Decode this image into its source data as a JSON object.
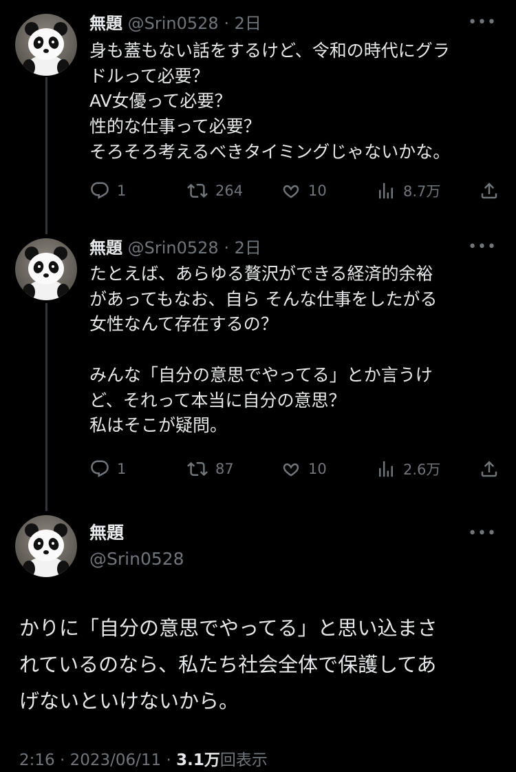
{
  "tweets": [
    {
      "display_name": "無題",
      "handle": "@Srin0528",
      "time": "2日",
      "text": "身も蓋もない話をするけど、令和の時代にグラ\nドルって必要？\nAV女優って必要？\n性的な仕事って必要？\nそろそろ考えるべきタイミングじゃないかな。",
      "replies": "1",
      "retweets": "264",
      "likes": "10",
      "views": "8.7万"
    },
    {
      "display_name": "無題",
      "handle": "@Srin0528",
      "time": "2日",
      "text": "たとえば、あらゆる贅沢ができる経済的余裕\nがあってもなお、自ら そんな仕事をしたがる\n女性なんて存在するの？\n\nみんな「自分の意思でやってる」とか言うけ\nど、それって本当に自分の意思？\n私はそこが疑問。",
      "replies": "1",
      "retweets": "87",
      "likes": "10",
      "views": "2.6万"
    }
  ],
  "main_tweet": {
    "display_name": "無題",
    "handle": "@Srin0528",
    "text": "かりに「自分の意思でやってる」と思い込まさ\nれているのなら、私たち社会全体で保護してあ\nげないといけないから。",
    "time": "2:16",
    "date": "2023/06/11",
    "views_count": "3.1万",
    "views_label": "回表示"
  },
  "colors": {
    "background": "#000000",
    "text": "#e7e9ea",
    "muted": "#71767b",
    "thread_line": "#333639"
  },
  "icons": [
    "reply-icon",
    "retweet-icon",
    "like-icon",
    "views-icon",
    "share-icon",
    "more-icon"
  ]
}
